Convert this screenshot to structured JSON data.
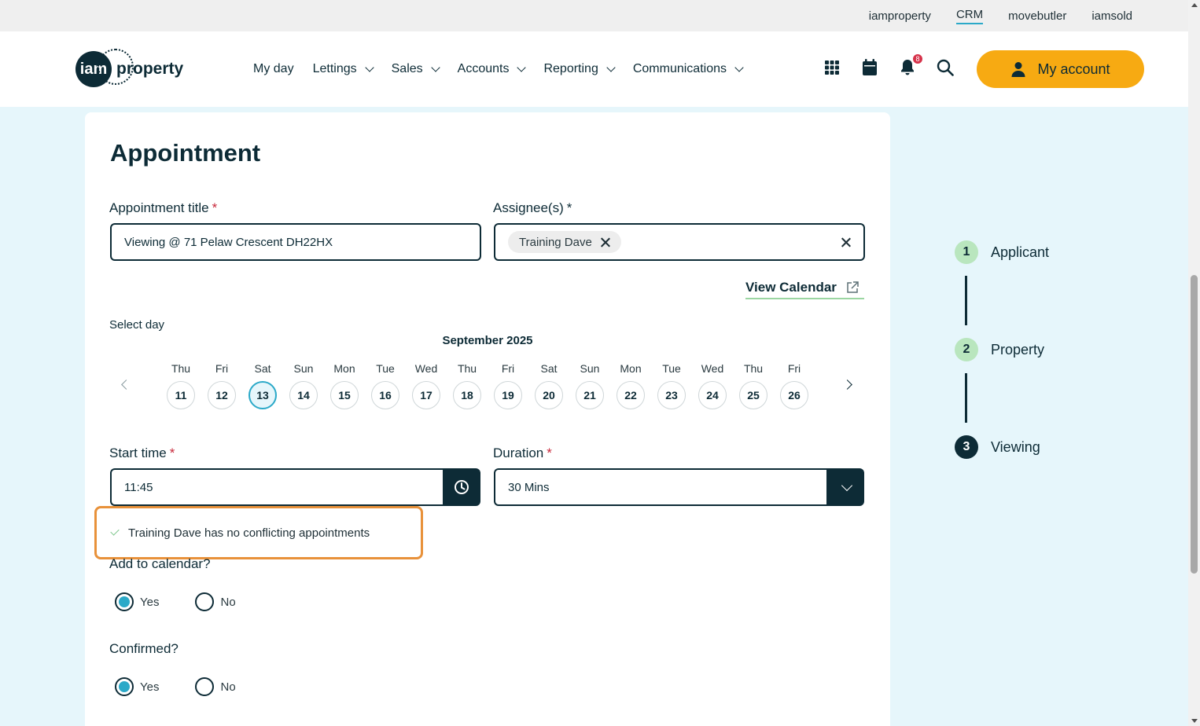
{
  "util_links": [
    {
      "label": "iamproperty",
      "active": false
    },
    {
      "label": "CRM",
      "active": true
    },
    {
      "label": "movebutler",
      "active": false
    },
    {
      "label": "iamsold",
      "active": false
    }
  ],
  "logo": {
    "mark": "iam",
    "text": "property"
  },
  "nav": [
    {
      "label": "My day",
      "dropdown": false
    },
    {
      "label": "Lettings",
      "dropdown": true
    },
    {
      "label": "Sales",
      "dropdown": true
    },
    {
      "label": "Accounts",
      "dropdown": true
    },
    {
      "label": "Reporting",
      "dropdown": true
    },
    {
      "label": "Communications",
      "dropdown": true
    }
  ],
  "header_icons": {
    "notification_count": "8"
  },
  "account_label": "My account",
  "form": {
    "title": "Appointment",
    "appt_title_label": "Appointment title",
    "appt_title_value": "Viewing @ 71 Pelaw Crescent  DH22HX",
    "assignee_label": "Assignee(s)",
    "assignee_chip": "Training Dave",
    "view_calendar": "View Calendar",
    "select_day_label": "Select day",
    "month": "September 2025",
    "days": [
      {
        "name": "Thu",
        "num": "11"
      },
      {
        "name": "Fri",
        "num": "12"
      },
      {
        "name": "Sat",
        "num": "13",
        "selected": true
      },
      {
        "name": "Sun",
        "num": "14"
      },
      {
        "name": "Mon",
        "num": "15"
      },
      {
        "name": "Tue",
        "num": "16"
      },
      {
        "name": "Wed",
        "num": "17"
      },
      {
        "name": "Thu",
        "num": "18"
      },
      {
        "name": "Fri",
        "num": "19"
      },
      {
        "name": "Sat",
        "num": "20"
      },
      {
        "name": "Sun",
        "num": "21"
      },
      {
        "name": "Mon",
        "num": "22"
      },
      {
        "name": "Tue",
        "num": "23"
      },
      {
        "name": "Wed",
        "num": "24"
      },
      {
        "name": "Thu",
        "num": "25"
      },
      {
        "name": "Fri",
        "num": "26"
      }
    ],
    "start_time_label": "Start time",
    "start_time_value": "11:45",
    "duration_label": "Duration",
    "duration_value": "30 Mins",
    "conflict_message": "Training Dave has no conflicting appointments",
    "add_calendar_label": "Add to calendar?",
    "confirmed_label": "Confirmed?",
    "yes_label": "Yes",
    "no_label": "No"
  },
  "steps": [
    {
      "num": "1",
      "label": "Applicant"
    },
    {
      "num": "2",
      "label": "Property"
    },
    {
      "num": "3",
      "label": "Viewing"
    }
  ],
  "colors": {
    "accent": "#f7aa12",
    "primary": "#0d2b36",
    "highlight": "#2ba9c8",
    "conflict_border": "#e8913a"
  }
}
